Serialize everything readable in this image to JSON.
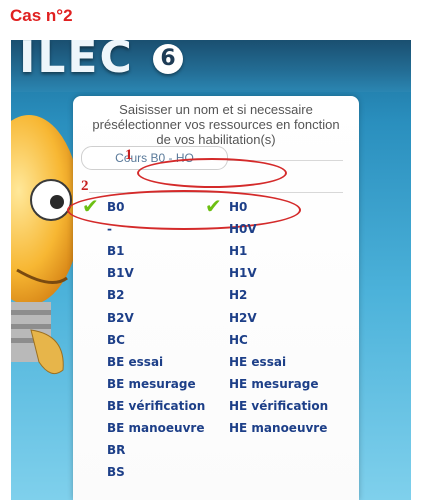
{
  "caption": "Cas n°2",
  "app": {
    "logo_text": "ILEC",
    "logo_badge": "6"
  },
  "panel": {
    "prompt_lines": [
      "Saisisser un nom et si necessaire",
      "présélectionner vos ressources en fonction",
      "de vos habilitation(s)"
    ],
    "profile_value": "Cours B0 - HO"
  },
  "annotations": {
    "one": "1",
    "two": "2"
  },
  "left_column": [
    {
      "label": "B0",
      "checked": true
    },
    {
      "label": "-",
      "checked": false
    },
    {
      "label": "B1",
      "checked": false
    },
    {
      "label": "B1V",
      "checked": false
    },
    {
      "label": "B2",
      "checked": false
    },
    {
      "label": "B2V",
      "checked": false
    },
    {
      "label": "BC",
      "checked": false
    },
    {
      "label": "BE essai",
      "checked": false
    },
    {
      "label": "BE mesurage",
      "checked": false
    },
    {
      "label": "BE vérification",
      "checked": false
    },
    {
      "label": "BE manoeuvre",
      "checked": false
    },
    {
      "label": "BR",
      "checked": false
    },
    {
      "label": "BS",
      "checked": false
    }
  ],
  "right_column": [
    {
      "label": "H0",
      "checked": true
    },
    {
      "label": "H0V",
      "checked": false
    },
    {
      "label": "H1",
      "checked": false
    },
    {
      "label": "H1V",
      "checked": false
    },
    {
      "label": "H2",
      "checked": false
    },
    {
      "label": "H2V",
      "checked": false
    },
    {
      "label": "HC",
      "checked": false
    },
    {
      "label": "HE essai",
      "checked": false
    },
    {
      "label": "HE mesurage",
      "checked": false
    },
    {
      "label": "HE vérification",
      "checked": false
    },
    {
      "label": "HE manoeuvre",
      "checked": false
    }
  ],
  "colors": {
    "accent_red": "#d42a2a",
    "item_blue": "#1d3f88",
    "check_green": "#6cbf12"
  }
}
